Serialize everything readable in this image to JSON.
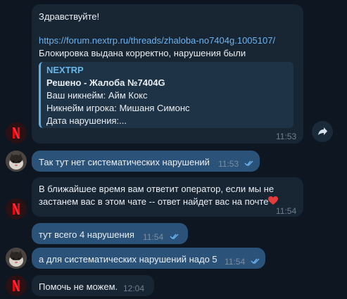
{
  "messages": {
    "m1": {
      "greeting": "Здравствуйте!",
      "link": "https://forum.nextrp.ru/threads/zhaloba-no7404g.1005107/",
      "line": "Блокировка выдана корректно, нарушения были",
      "quote": {
        "title": "NEXTRP",
        "subject": "Решено - Жалоба №7404G",
        "nick": "Ваш никнейм: Айм Кокс",
        "player": "Никнейм игрока: Мишаня Симонс",
        "date": "Дата нарушения:..."
      },
      "time": "11:53"
    },
    "m2": {
      "text": "Так тут нет систематических нарушений",
      "time": "11:53"
    },
    "m3": {
      "line1": "В ближайшее время вам ответит оператор, если мы не",
      "line2": "застанем вас в этом чате -- ответ найдет вас на почте",
      "time": "11:54"
    },
    "m4": {
      "text": "тут всего 4 нарушения",
      "time": "11:54"
    },
    "m5": {
      "text": "а для систематических нарушений надо 5",
      "time": "11:54"
    },
    "m6": {
      "text": "Помочь не можем.",
      "time": "12:04"
    }
  },
  "icons": {
    "bot_avatar": "netflix-style-n-icon",
    "user_avatar": "cat-avatar-icon",
    "share": "share-arrow-icon",
    "heart": "heart-icon",
    "read_ticks": "double-check-icon"
  },
  "colors": {
    "background": "#0e1621",
    "bubble": "#182533",
    "outgoing_bubble": "#2b5278",
    "link": "#6ab3f3",
    "accent": "#e50914"
  }
}
